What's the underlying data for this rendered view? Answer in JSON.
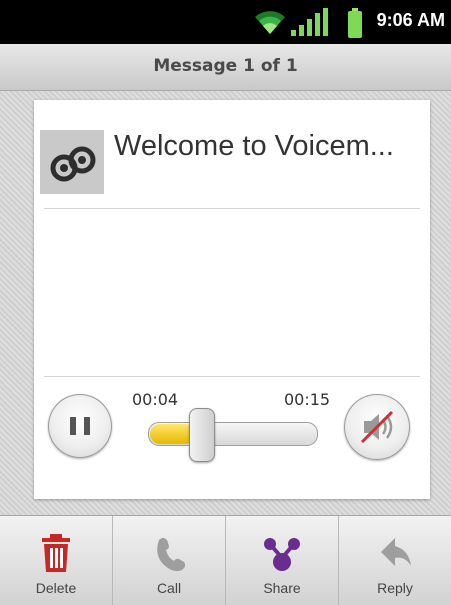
{
  "status_bar": {
    "time": "9:06 AM"
  },
  "header": {
    "title": "Message 1 of 1"
  },
  "voicemail": {
    "title": "Welcome to Voicem..."
  },
  "player": {
    "current_time": "00:04",
    "total_time": "00:15",
    "progress": 0.27,
    "speaker_muted": true
  },
  "actions": [
    {
      "label": "Delete",
      "icon": "trash-icon",
      "color": "#c62828"
    },
    {
      "label": "Call",
      "icon": "phone-icon",
      "color": "#9e9e9e"
    },
    {
      "label": "Share",
      "icon": "share-icon",
      "color": "#6a2c91"
    },
    {
      "label": "Reply",
      "icon": "reply-icon",
      "color": "#9e9e9e"
    }
  ]
}
